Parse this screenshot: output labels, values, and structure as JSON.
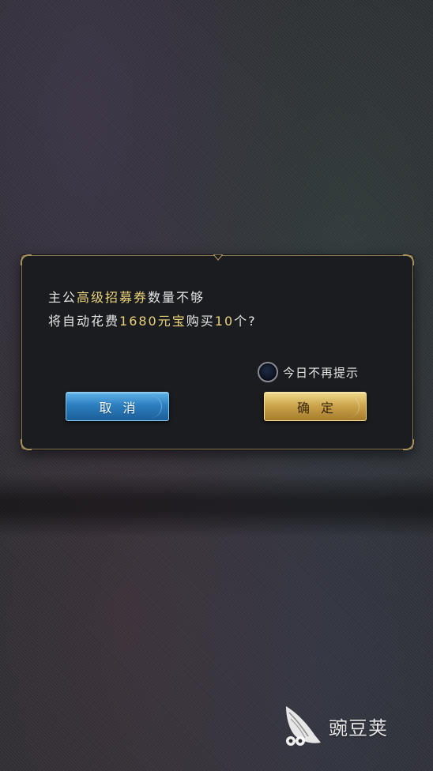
{
  "dialog": {
    "message_line1": {
      "prefix": "主公",
      "highlight": "高级招募券",
      "suffix": "数量不够"
    },
    "message_line2": {
      "prefix": "将自动花费",
      "highlight_cost": "1680元宝",
      "middle": "购买",
      "highlight_count": "10",
      "suffix": "个?"
    },
    "checkbox": {
      "label": "今日不再提示",
      "checked": false
    },
    "cancel_label": "取消",
    "confirm_label": "确定"
  },
  "watermark": {
    "text": "豌豆荚",
    "icon": "peapod-logo-icon"
  },
  "colors": {
    "highlight": "#e8d27a",
    "dialog_bg": "#1b1c1f",
    "frame": "#8c7a55",
    "cancel_button": "#2c7fc0",
    "confirm_button": "#c9a24a"
  }
}
